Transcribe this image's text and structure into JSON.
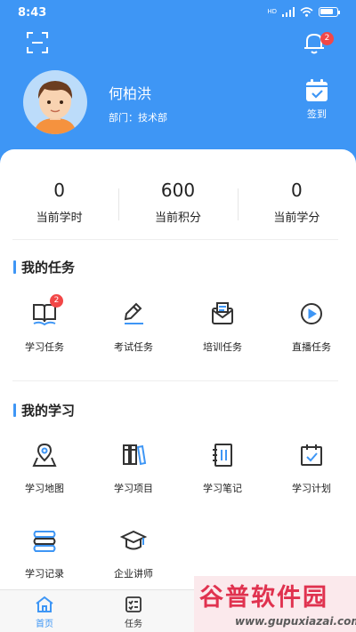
{
  "status_bar": {
    "time": "8:43",
    "network": "HD",
    "icons": [
      "hd-signal-icon",
      "wifi-icon",
      "battery-icon"
    ]
  },
  "header": {
    "scan_icon": "scan-icon",
    "notification": {
      "icon": "bell-icon",
      "badge": "2"
    },
    "user": {
      "name": "何柏洪",
      "department": "部门：技术部"
    },
    "signin": {
      "icon": "calendar-check-icon",
      "label": "签到"
    }
  },
  "stats": [
    {
      "value": "0",
      "label": "当前学时"
    },
    {
      "value": "600",
      "label": "当前积分"
    },
    {
      "value": "0",
      "label": "当前学分"
    }
  ],
  "my_tasks": {
    "title": "我的任务",
    "items": [
      {
        "label": "学习任务",
        "icon": "book-icon",
        "badge": "2"
      },
      {
        "label": "考试任务",
        "icon": "pen-icon"
      },
      {
        "label": "培训任务",
        "icon": "envelope-icon"
      },
      {
        "label": "直播任务",
        "icon": "play-icon"
      }
    ]
  },
  "my_learning": {
    "title": "我的学习",
    "items": [
      {
        "label": "学习地图",
        "icon": "map-pin-icon"
      },
      {
        "label": "学习项目",
        "icon": "books-icon"
      },
      {
        "label": "学习笔记",
        "icon": "notebook-icon"
      },
      {
        "label": "学习计划",
        "icon": "calendar-icon"
      },
      {
        "label": "学习记录",
        "icon": "record-icon"
      },
      {
        "label": "企业讲师",
        "icon": "graduation-cap-icon"
      }
    ]
  },
  "tabbar": [
    {
      "label": "首页",
      "icon": "home-icon",
      "active": true
    },
    {
      "label": "任务",
      "icon": "task-list-icon",
      "active": false
    }
  ],
  "watermark": {
    "title": "谷普软件园",
    "url": "www.gupuxiazai.com"
  },
  "colors": {
    "primary": "#3e96f5",
    "badge": "#f24747",
    "text": "#222222",
    "watermark": "#e0324f"
  }
}
